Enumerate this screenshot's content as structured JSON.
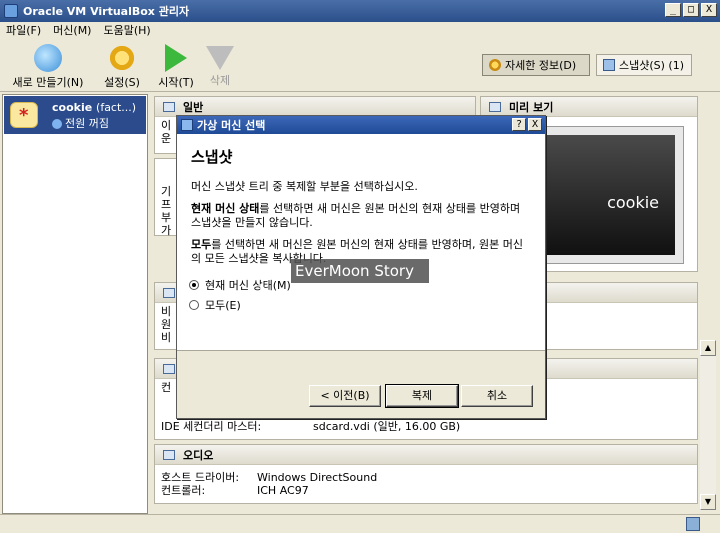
{
  "window": {
    "title": "Oracle VM VirtualBox 관리자",
    "controls": [
      "_",
      "□",
      "X"
    ]
  },
  "menu": [
    "파일(F)",
    "머신(M)",
    "도움말(H)"
  ],
  "toolbar": {
    "new_label": "새로 만들기(N)",
    "settings_label": "설정(S)",
    "start_label": "시작(T)",
    "delete_label": "삭제",
    "details_label": "자세한 정보(D)",
    "snapshots_label": "스냅샷(S) (1)"
  },
  "vm": {
    "name": "cookie",
    "snapshot_hint": "(fact...)",
    "state": "전원 꺼짐"
  },
  "panels": {
    "general_title": "일반",
    "general_lines": [
      "이",
      "운"
    ],
    "system_lines": [
      "기",
      "프",
      "부",
      "가"
    ],
    "display_lines": [
      "비",
      "원",
      "비"
    ],
    "storage_lines": [
      "컨"
    ],
    "preview_title": "미리 보기",
    "preview_text": "cookie",
    "ide_secondary_key": "IDE 세컨더리 마스터:",
    "ide_secondary_val": "sdcard.vdi (일반, 16.00 GB)",
    "audio_title": "오디오",
    "audio_rows": [
      {
        "k": "호스트 드라이버:",
        "v": "Windows DirectSound"
      },
      {
        "k": "컨트롤러:",
        "v": "ICH AC97"
      }
    ]
  },
  "dialog": {
    "title": "가상 머신 선택",
    "help_btn": "?",
    "close_btn": "X",
    "heading": "스냅샷",
    "para1": "머신 스냅샷 트리 중 복제할 부분을 선택하십시오.",
    "para2_bold": "현재 머신 상태",
    "para2_rest": "를 선택하면 새 머신은 원본 머신의 현재 상태를 반영하며 스냅샷을 만들지 않습니다.",
    "para3_bold": "모두",
    "para3_rest": "를 선택하면 새 머신은 원본 머신의 현재 상태를 반영하며, 원본 머신의 모든 스냅샷을 복사합니다.",
    "option_current": "현재 머신 상태(M)",
    "option_all": "모두(E)",
    "selected": "current",
    "back_btn": "< 이전(B)",
    "clone_btn": "복제",
    "cancel_btn": "취소"
  },
  "watermark": "EverMoon Story"
}
